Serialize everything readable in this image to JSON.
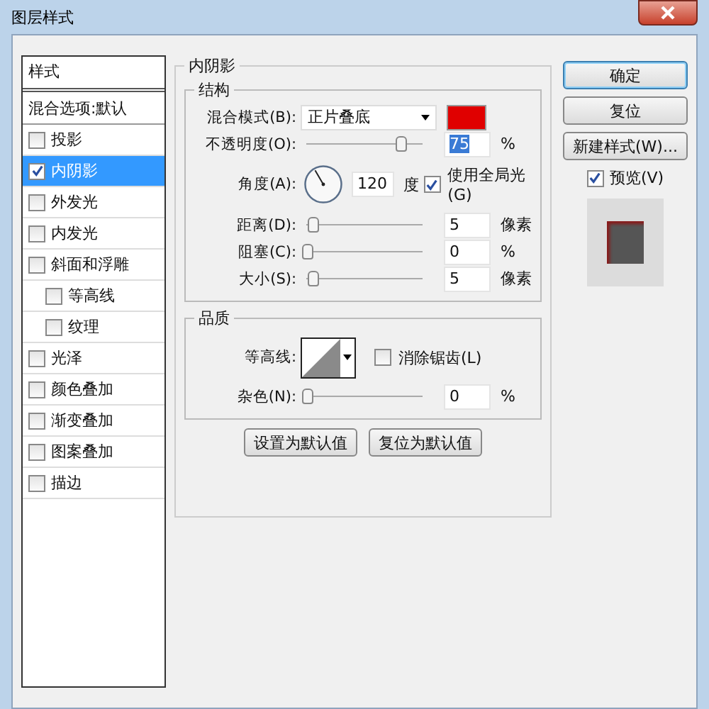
{
  "window": {
    "title": "图层样式"
  },
  "sidebar": {
    "header": "样式",
    "blend_options": "混合选项:默认",
    "items": [
      {
        "label": "投影",
        "checked": false,
        "selected": false
      },
      {
        "label": "内阴影",
        "checked": true,
        "selected": true
      },
      {
        "label": "外发光",
        "checked": false,
        "selected": false
      },
      {
        "label": "内发光",
        "checked": false,
        "selected": false
      },
      {
        "label": "斜面和浮雕",
        "checked": false,
        "selected": false,
        "children": [
          {
            "label": "等高线",
            "checked": false,
            "selected": false
          },
          {
            "label": "纹理",
            "checked": false,
            "selected": false
          }
        ]
      },
      {
        "label": "光泽",
        "checked": false,
        "selected": false
      },
      {
        "label": "颜色叠加",
        "checked": false,
        "selected": false
      },
      {
        "label": "渐变叠加",
        "checked": false,
        "selected": false
      },
      {
        "label": "图案叠加",
        "checked": false,
        "selected": false
      },
      {
        "label": "描边",
        "checked": false,
        "selected": false
      }
    ]
  },
  "panel": {
    "title": "内阴影",
    "structure": {
      "title": "结构",
      "blend_mode_label": "混合模式(B):",
      "blend_mode": "正片叠底",
      "color": "#e00000",
      "opacity": {
        "label": "不透明度(O):",
        "level": 0.8,
        "value": "75",
        "unit": "%"
      },
      "angle": {
        "label": "角度(A):",
        "value": "120",
        "unit": "度",
        "global_light": {
          "label": "使用全局光(G)",
          "checked": true
        }
      },
      "sliders": [
        {
          "label": "距离(D):",
          "level": 0.05,
          "value": "5",
          "unit": "像素"
        },
        {
          "label": "阻塞(C):",
          "level": 0,
          "value": "0",
          "unit": "%"
        },
        {
          "label": "大小(S):",
          "level": 0.05,
          "value": "5",
          "unit": "像素"
        }
      ]
    },
    "quality": {
      "title": "品质",
      "contour_label": "等高线:",
      "anti_alias": {
        "label": "消除锯齿(L)",
        "checked": false
      },
      "noise": {
        "label": "杂色(N):",
        "level": 0,
        "value": "0",
        "unit": "%"
      }
    },
    "buttons": [
      "设置为默认值",
      "复位为默认值"
    ]
  },
  "actions": {
    "buttons": [
      "确定",
      "复位",
      "新建样式(W)..."
    ],
    "preview": {
      "label": "预览(V)",
      "checked": true
    }
  }
}
